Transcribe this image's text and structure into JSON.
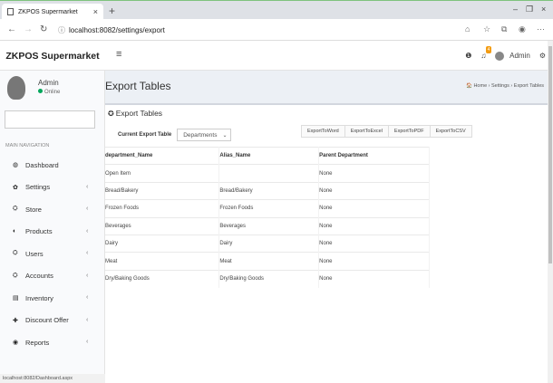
{
  "browser": {
    "tab_title": "ZKPOS Supermarket",
    "tab_close": "×",
    "new_tab": "+",
    "url": "localhost:8082/settings/export",
    "win_min": "–",
    "win_max": "❐",
    "win_close": "×"
  },
  "header": {
    "brand": "ZKPOS Supermarket",
    "menu_icon": "≡",
    "notif_count": "4",
    "user": "Admin"
  },
  "sidebar": {
    "user_name": "Admin",
    "user_status": "Online",
    "search_placeholder": "",
    "heading": "MAIN NAVIGATION",
    "items": [
      {
        "label": "Dashboard",
        "icon": "dashboard-icon",
        "glyph": "◍",
        "has_chevron": false
      },
      {
        "label": "Settings",
        "icon": "gear-icon",
        "glyph": "✿",
        "has_chevron": true
      },
      {
        "label": "Store",
        "icon": "store-icon",
        "glyph": "⛭",
        "has_chevron": true
      },
      {
        "label": "Products",
        "icon": "products-icon",
        "glyph": "◐",
        "has_chevron": true
      },
      {
        "label": "Users",
        "icon": "users-icon",
        "glyph": "⛭",
        "has_chevron": true
      },
      {
        "label": "Accounts",
        "icon": "accounts-icon",
        "glyph": "⛭",
        "has_chevron": true
      },
      {
        "label": "Inventory",
        "icon": "inventory-icon",
        "glyph": "▤",
        "has_chevron": true
      },
      {
        "label": "Discount Offer",
        "icon": "plus-icon",
        "glyph": "✚",
        "has_chevron": true
      },
      {
        "label": "Reports",
        "icon": "reports-icon",
        "glyph": "◉",
        "has_chevron": true
      }
    ],
    "status_url": "localhost:8082/Dashboard.aspx"
  },
  "page": {
    "title": "Export Tables",
    "breadcrumb": "🏠 Home  ›  Settings  ›  Export Tables",
    "box_title": "Export Tables",
    "current_label": "Current Export Table",
    "select_value": "Departments",
    "export_buttons": [
      "ExportToWord",
      "ExportToExcel",
      "ExportToPDF",
      "ExportToCSV"
    ]
  },
  "table": {
    "headers": [
      "department_Name",
      "Alias_Name",
      "Parent Department"
    ],
    "rows": [
      [
        "Open Item",
        "",
        "None"
      ],
      [
        "Bread/Bakery",
        "Bread/Bakery",
        "None"
      ],
      [
        "Frozen Foods",
        "Frozen Foods",
        "None"
      ],
      [
        "Beverages",
        "Beverages",
        "None"
      ],
      [
        "Dairy",
        "Dairy",
        "None"
      ],
      [
        "Meat",
        "Meat",
        "None"
      ],
      [
        "Dry/Baking Goods",
        "Dry/Baking Goods",
        "None"
      ]
    ]
  }
}
